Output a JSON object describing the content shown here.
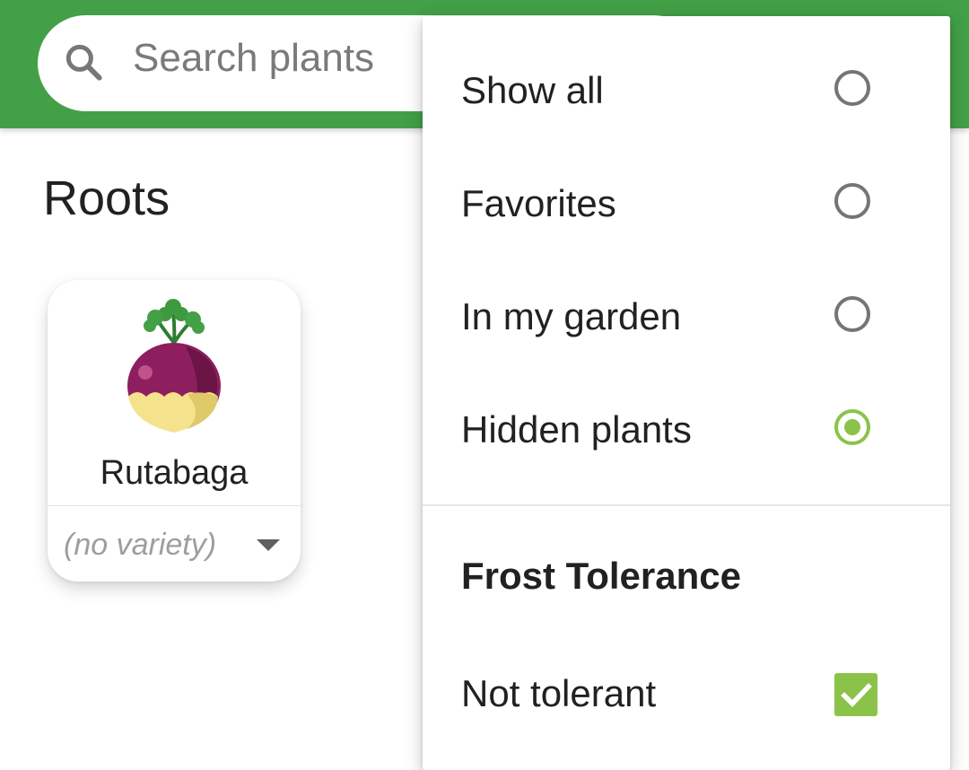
{
  "search": {
    "placeholder": "Search plants"
  },
  "section": {
    "title": "Roots"
  },
  "card": {
    "name": "Rutabaga",
    "variety": "(no variety)"
  },
  "filter_menu": {
    "options": [
      {
        "label": "Show all",
        "selected": false
      },
      {
        "label": "Favorites",
        "selected": false
      },
      {
        "label": "In my garden",
        "selected": false
      },
      {
        "label": "Hidden plants",
        "selected": true
      }
    ],
    "frost_header": "Frost Tolerance",
    "frost_options": [
      {
        "label": "Not tolerant",
        "checked": true
      }
    ]
  },
  "colors": {
    "appbar": "#43a047",
    "accent": "#8bc34a",
    "rutabaga_purple": "#8e1f5e",
    "rutabaga_yellow": "#f4e38c",
    "leaf_green": "#3e9a3e"
  },
  "icons": {
    "search": "search-icon",
    "variety_dropdown": "caret-down-icon",
    "plant": "rutabaga-icon",
    "radio": "radio-button-icon",
    "checkbox": "checkbox-checked-icon"
  }
}
